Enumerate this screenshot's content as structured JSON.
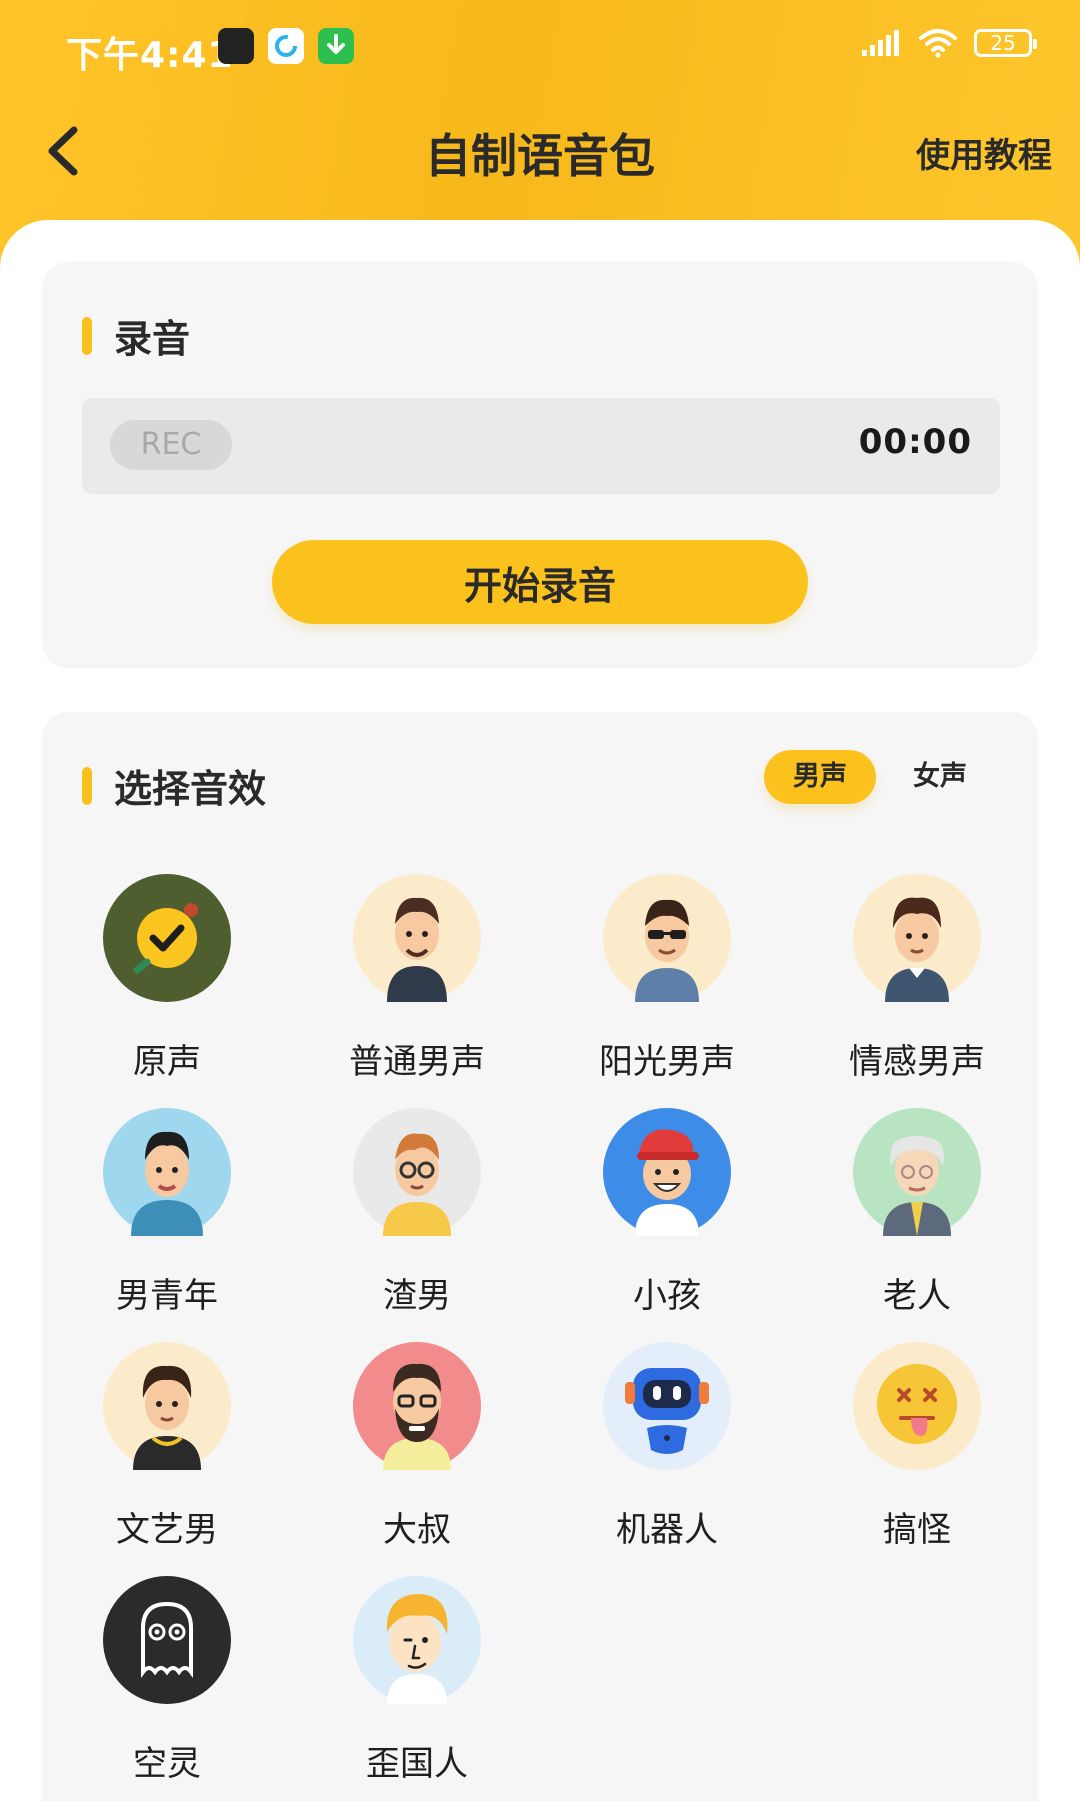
{
  "status_bar": {
    "time": "下午4:41",
    "battery": "25"
  },
  "nav": {
    "title": "自制语音包",
    "tutorial": "使用教程"
  },
  "record_section": {
    "title": "录音",
    "rec_badge": "REC",
    "timer": "00:00",
    "start_button": "开始录音"
  },
  "effects_section": {
    "title": "选择音效",
    "gender_tabs": [
      "男声",
      "女声"
    ],
    "selected_gender": "男声",
    "items": [
      {
        "label": "原声",
        "icon": "original-voice-icon"
      },
      {
        "label": "普通男声",
        "icon": "ordinary-male-icon"
      },
      {
        "label": "阳光男声",
        "icon": "sunny-male-icon"
      },
      {
        "label": "情感男声",
        "icon": "emotional-male-icon"
      },
      {
        "label": "男青年",
        "icon": "young-man-icon"
      },
      {
        "label": "渣男",
        "icon": "playboy-icon"
      },
      {
        "label": "小孩",
        "icon": "child-icon"
      },
      {
        "label": "老人",
        "icon": "old-man-icon"
      },
      {
        "label": "文艺男",
        "icon": "artsy-man-icon"
      },
      {
        "label": "大叔",
        "icon": "uncle-icon"
      },
      {
        "label": "机器人",
        "icon": "robot-icon"
      },
      {
        "label": "搞怪",
        "icon": "funny-face-icon"
      },
      {
        "label": "空灵",
        "icon": "ghost-icon"
      },
      {
        "label": "歪国人",
        "icon": "foreigner-icon"
      }
    ]
  },
  "colors": {
    "accent": "#FBC21D",
    "card_bg": "#F6F6F6"
  }
}
